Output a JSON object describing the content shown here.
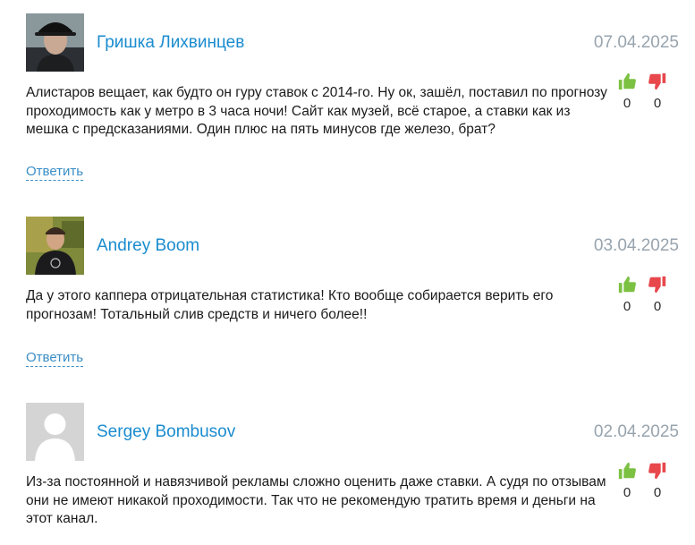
{
  "comments": [
    {
      "author": "Гришка Лихвинцев",
      "date": "07.04.2025",
      "text": "Алистаров вещает, как будто он гуру ставок с 2014-го. Ну ок, зашёл, поставил по прогнозу проходимость как у метро в 3 часа ночи! Сайт как музей, всё старое, а ставки как из мешка с предсказаниями. Один плюс на пять минусов где железо, брат?",
      "likes": "0",
      "dislikes": "0",
      "reply": "Ответить",
      "avatar": "user-photo-avatar"
    },
    {
      "author": "Andrey Boom",
      "date": "03.04.2025",
      "text": "Да у этого каппера отрицательная статистика! Кто вообще собирается верить его прогнозам! Тотальный слив средств и ничего более!!",
      "likes": "0",
      "dislikes": "0",
      "reply": "Ответить",
      "avatar": "user-photo-avatar"
    },
    {
      "author": "Sergey Bombusov",
      "date": "02.04.2025",
      "text": "Из-за постоянной и навязчивой рекламы сложно оценить даже ставки. А судя по отзывам они не имеют никакой проходимости. Так что не рекомендую тратить время и деньги на этот канал.",
      "likes": "0",
      "dislikes": "0",
      "avatar": "default-user-avatar"
    }
  ],
  "colors": {
    "author": "#1a8ccf",
    "date": "#98a4ae",
    "like": "#7cc142",
    "dislike": "#e8474c",
    "reply": "#3a8ec6"
  },
  "icons": {
    "like": "thumbs-up-icon",
    "dislike": "thumbs-down-icon"
  }
}
